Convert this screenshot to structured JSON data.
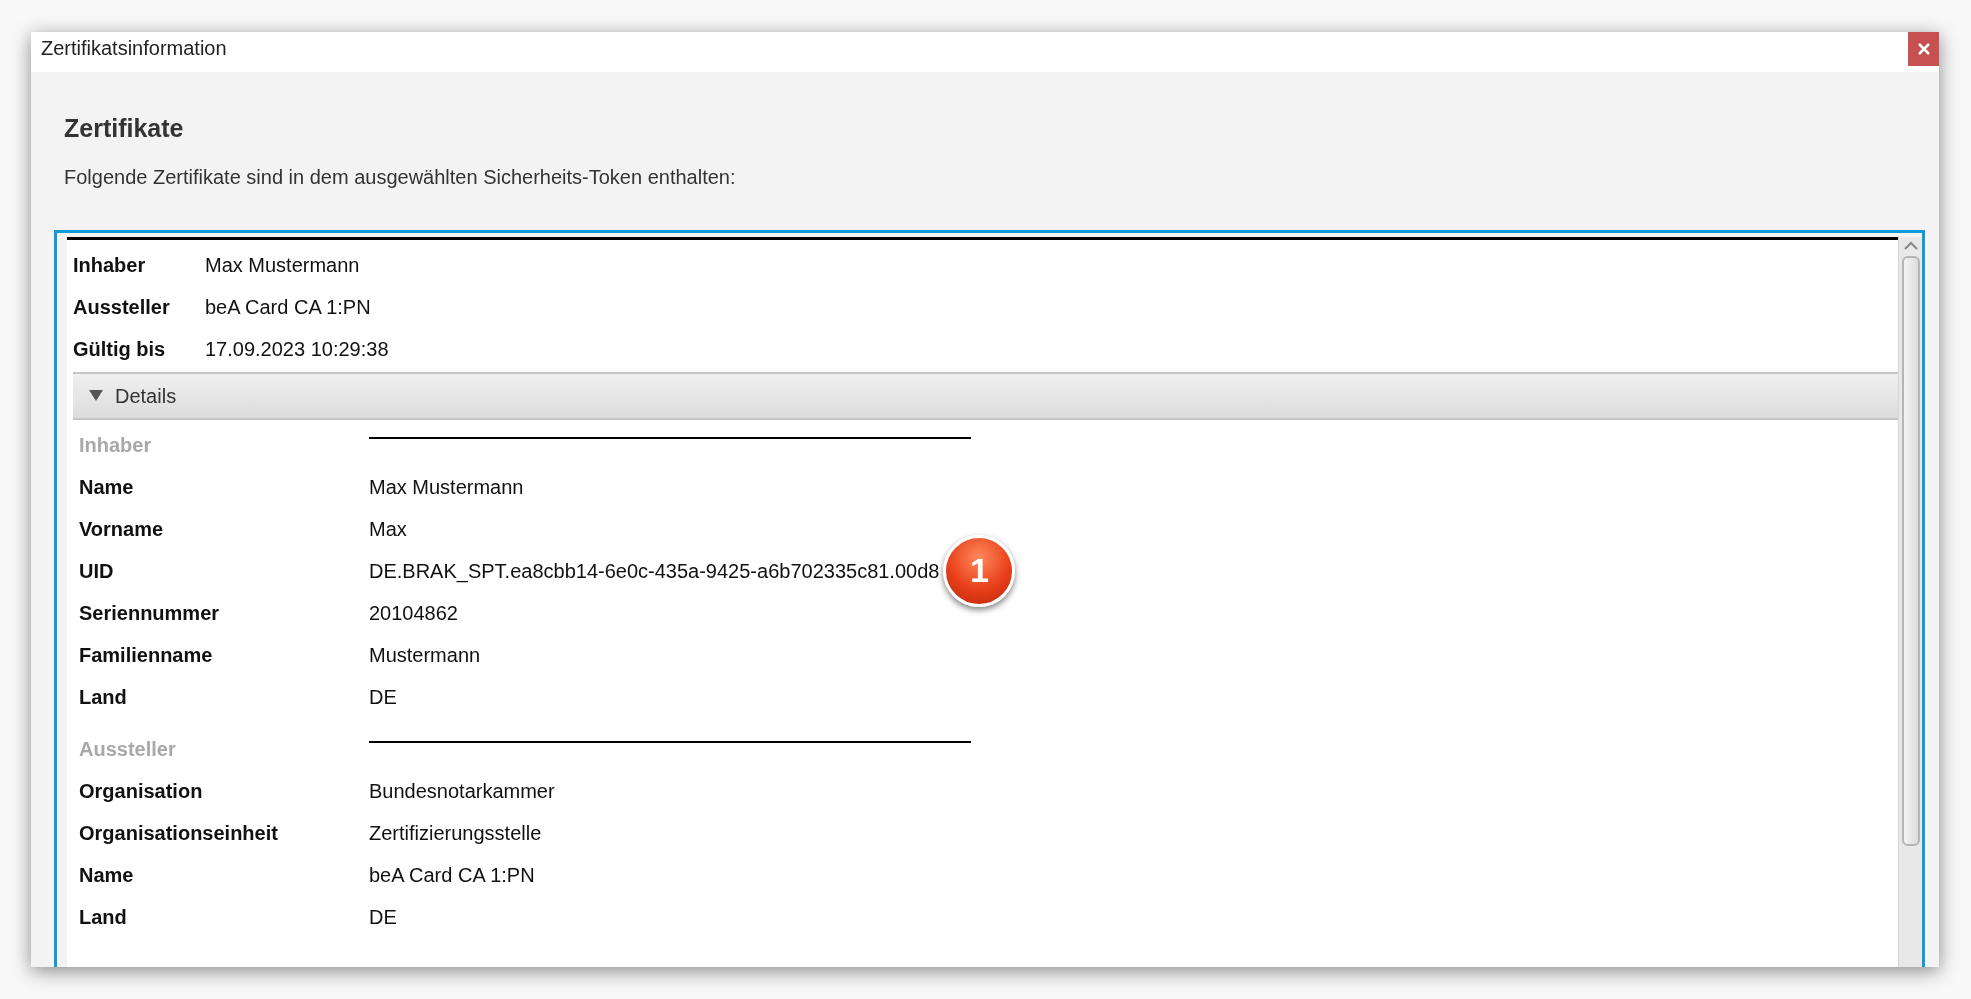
{
  "window": {
    "title": "Zertifikatsinformation"
  },
  "heading": "Zertifikate",
  "description": "Folgende Zertifikate sind in dem ausgewählten Sicherheits-Token enthalten:",
  "summary": [
    {
      "label": "Inhaber",
      "value": "Max Mustermann"
    },
    {
      "label": "Aussteller",
      "value": "beA Card CA 1:PN"
    },
    {
      "label": "Gültig bis",
      "value": "17.09.2023 10:29:38"
    }
  ],
  "details": {
    "label": "Details",
    "expanded": true,
    "sections": [
      {
        "title": "Inhaber",
        "fields": [
          {
            "label": "Name",
            "value": "Max Mustermann"
          },
          {
            "label": "Vorname",
            "value": "Max"
          },
          {
            "label": "UID",
            "value": "DE.BRAK_SPT.ea8cbb14-6e0c-435a-9425-a6b702335c81.00d8",
            "callout": "1"
          },
          {
            "label": "Seriennummer",
            "value": "20104862"
          },
          {
            "label": "Familienname",
            "value": "Mustermann"
          },
          {
            "label": "Land",
            "value": "DE"
          }
        ]
      },
      {
        "title": "Aussteller",
        "fields": [
          {
            "label": "Organisation",
            "value": "Bundesnotarkammer"
          },
          {
            "label": "Organisationseinheit",
            "value": "Zertifizierungsstelle"
          },
          {
            "label": "Name",
            "value": "beA Card CA 1:PN"
          },
          {
            "label": "Land",
            "value": "DE"
          }
        ]
      }
    ]
  }
}
